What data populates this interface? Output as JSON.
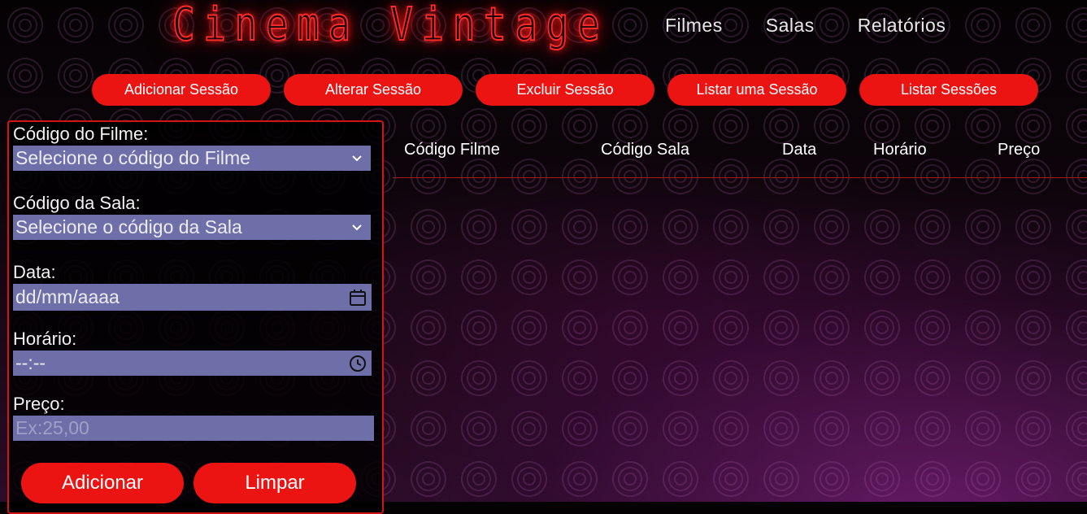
{
  "header": {
    "logo": "Cinema Vintage",
    "nav": [
      "Filmes",
      "Salas",
      "Relatórios"
    ]
  },
  "actions": [
    "Adicionar Sessão",
    "Alterar Sessão",
    "Excluir Sessão",
    "Listar uma Sessão",
    "Listar Sessões"
  ],
  "form": {
    "filme_label": "Código do Filme:",
    "filme_value": "Selecione o código do Filme",
    "sala_label": "Código da Sala:",
    "sala_value": "Selecione o código da Sala",
    "data_label": "Data:",
    "data_value": "dd/mm/aaaa",
    "horario_label": "Horário:",
    "horario_value": "--:--",
    "preco_label": "Preço:",
    "preco_placeholder": "Ex:25,00",
    "add_button": "Adicionar",
    "clear_button": "Limpar"
  },
  "table": {
    "columns": [
      "Código Filme",
      "Código Sala",
      "Data",
      "Horário",
      "Preço"
    ]
  },
  "colors": {
    "accent": "#ec1313",
    "field": "#6e6ea8"
  },
  "icons": {
    "select": "chevron-down-icon",
    "date": "calendar-icon",
    "time": "clock-icon"
  }
}
